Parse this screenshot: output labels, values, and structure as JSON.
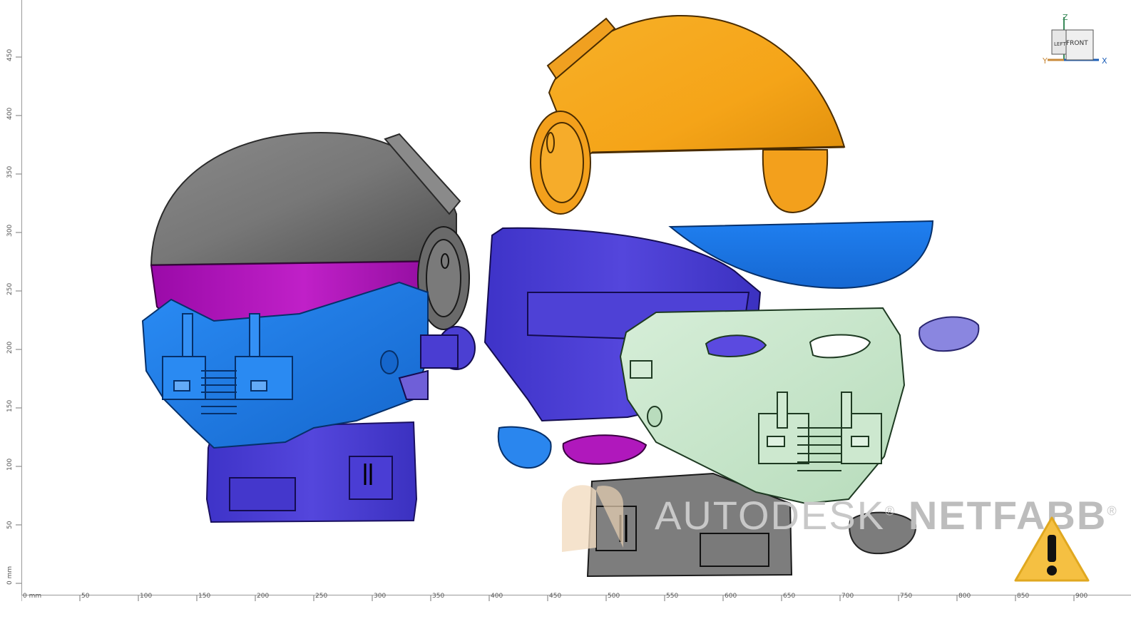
{
  "app": {
    "watermark_brand": "AUTODESK",
    "watermark_product": "NETFABB",
    "watermark_symbol": "®"
  },
  "viewcube": {
    "face_label": "FRONT",
    "side_label": "LEFT",
    "axis_x": "X",
    "axis_y": "Y",
    "axis_z": "Z"
  },
  "ruler_bottom": {
    "labels": [
      "0 mm",
      "50",
      "100",
      "150",
      "200",
      "250",
      "300",
      "350",
      "400",
      "450",
      "500",
      "550",
      "600",
      "650",
      "700",
      "750",
      "800",
      "850",
      "900"
    ]
  },
  "ruler_left": {
    "labels": [
      "0 mm",
      "50",
      "100",
      "150",
      "200",
      "250",
      "300",
      "350",
      "400",
      "450"
    ]
  },
  "icons": {
    "warning": "warning-icon",
    "netfabb_logo": "netfabb-logo-icon"
  },
  "colors": {
    "helmet_gray": "#6f6f6f",
    "visor_magenta": "#b015b8",
    "mask_blue": "#1a78e6",
    "neck_purple": "#4a3fd0",
    "shell_orange": "#f5a418",
    "face_mint": "#c9e6cc",
    "warning_yellow": "#f5c042"
  }
}
